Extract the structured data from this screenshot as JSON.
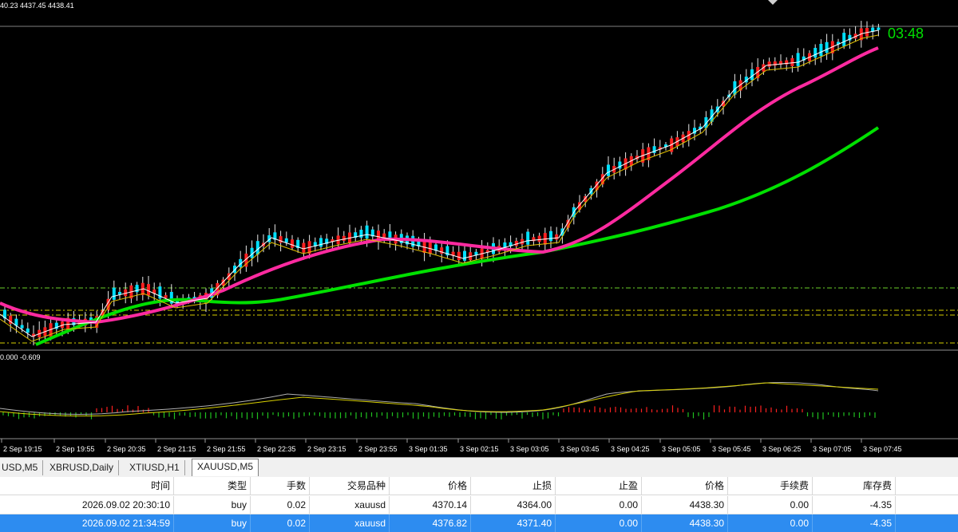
{
  "chart": {
    "ohlc_text": "40.23 4437.45 4438.41",
    "indicator_text": "0.000 -0.609",
    "countdown": "03:48",
    "time_labels": [
      "2 Sep 19:15",
      "2 Sep 19:55",
      "2 Sep 20:35",
      "2 Sep 21:15",
      "2 Sep 21:55",
      "2 Sep 22:35",
      "2 Sep 23:15",
      "2 Sep 23:55",
      "3 Sep 01:35",
      "3 Sep 02:15",
      "3 Sep 03:05",
      "3 Sep 03:45",
      "3 Sep 04:25",
      "3 Sep 05:05",
      "3 Sep 05:45",
      "3 Sep 06:25",
      "3 Sep 07:05",
      "3 Sep 07:45"
    ],
    "colors": {
      "bull": "#00e0ff",
      "bear": "#ff2020",
      "ma_slow": "#00e000",
      "ma_mid": "#ff2aa0",
      "ma_fast": "#ffffff",
      "ma_fast2": "#e0c000",
      "level_green": "#6ccf2a",
      "level_yellow": "#d8d000"
    }
  },
  "tabs": [
    {
      "label": "USD,M5"
    },
    {
      "label": "XBRUSD,Daily"
    },
    {
      "label": "XTIUSD,H1"
    },
    {
      "label": "XAUUSD,M5"
    }
  ],
  "table": {
    "headers": [
      "时间",
      "类型",
      "手数",
      "交易品种",
      "价格",
      "止损",
      "止盈",
      "价格",
      "手续费",
      "库存费"
    ],
    "rows": [
      [
        "2026.09.02 20:30:10",
        "buy",
        "0.02",
        "xauusd",
        "4370.14",
        "4364.00",
        "0.00",
        "4438.30",
        "0.00",
        "-4.35"
      ],
      [
        "2026.09.02 21:34:59",
        "buy",
        "0.02",
        "xauusd",
        "4376.82",
        "4371.40",
        "0.00",
        "4438.30",
        "0.00",
        "-4.35"
      ]
    ]
  }
}
